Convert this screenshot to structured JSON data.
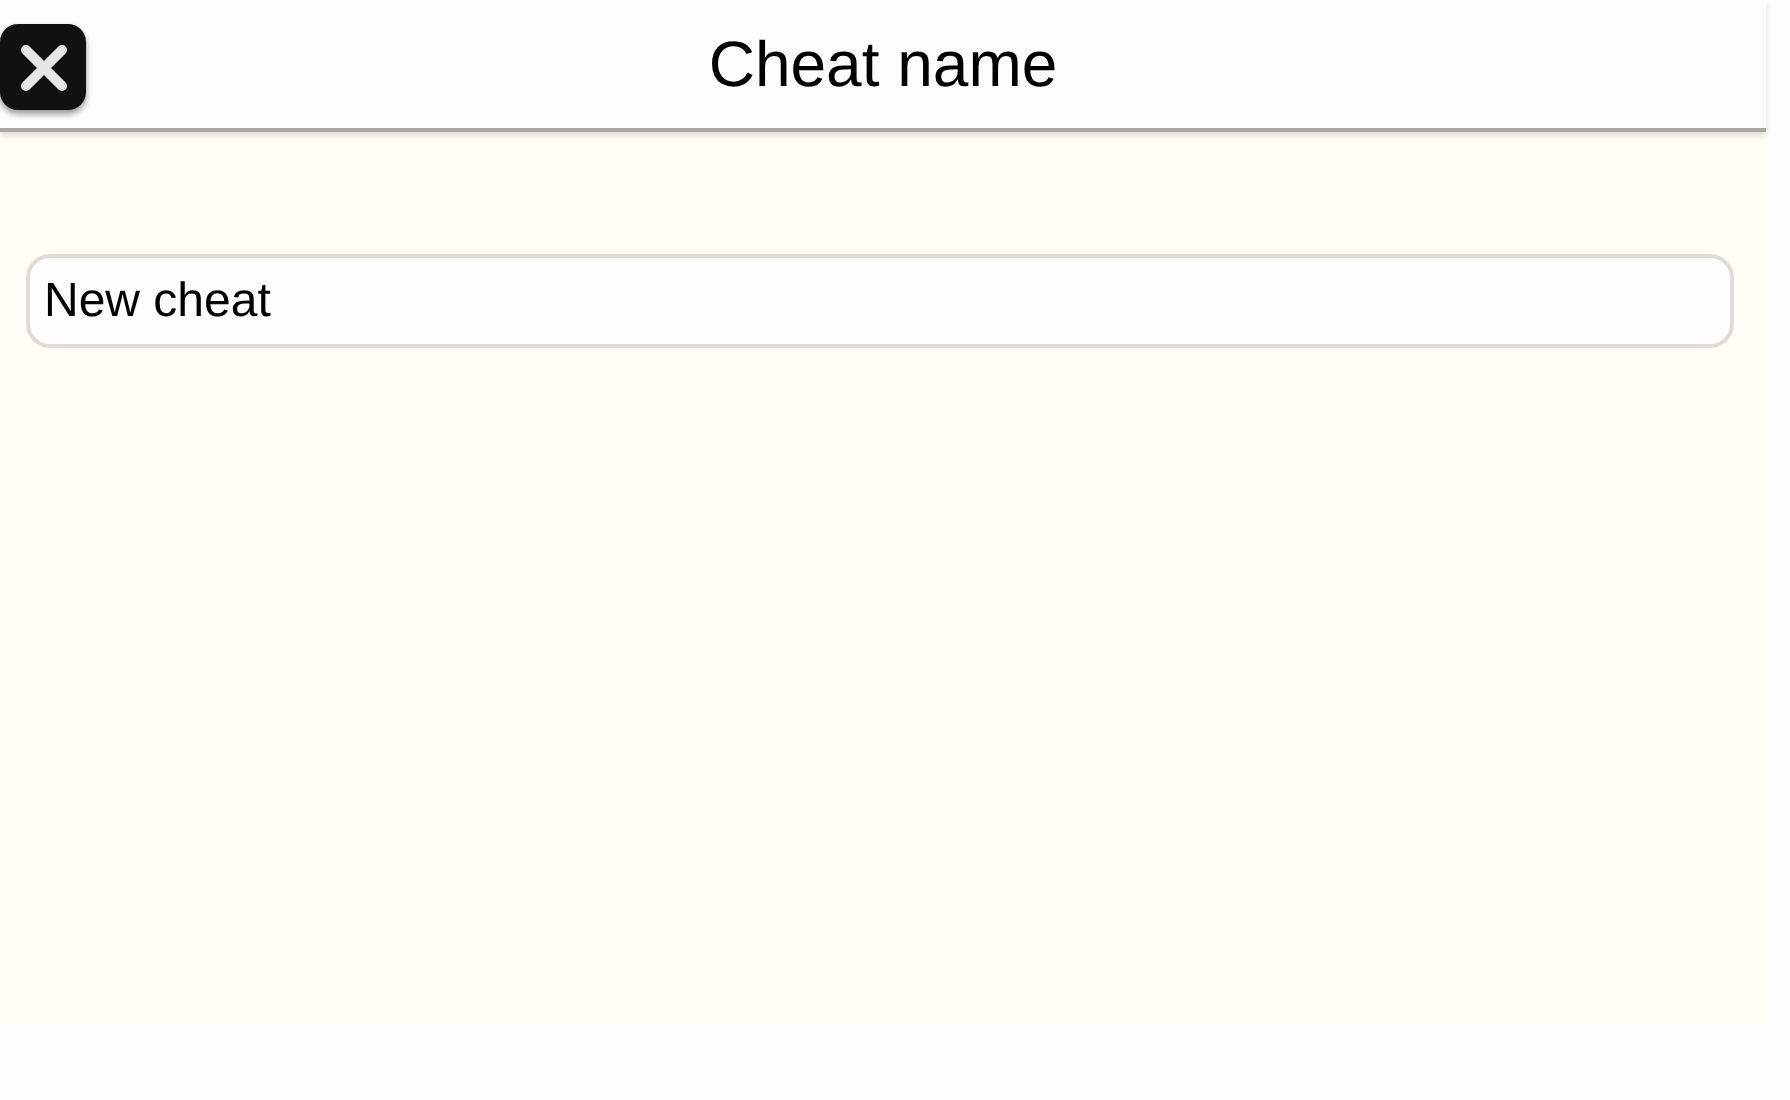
{
  "header": {
    "title": "Cheat name"
  },
  "name_field": {
    "value": "New cheat"
  }
}
